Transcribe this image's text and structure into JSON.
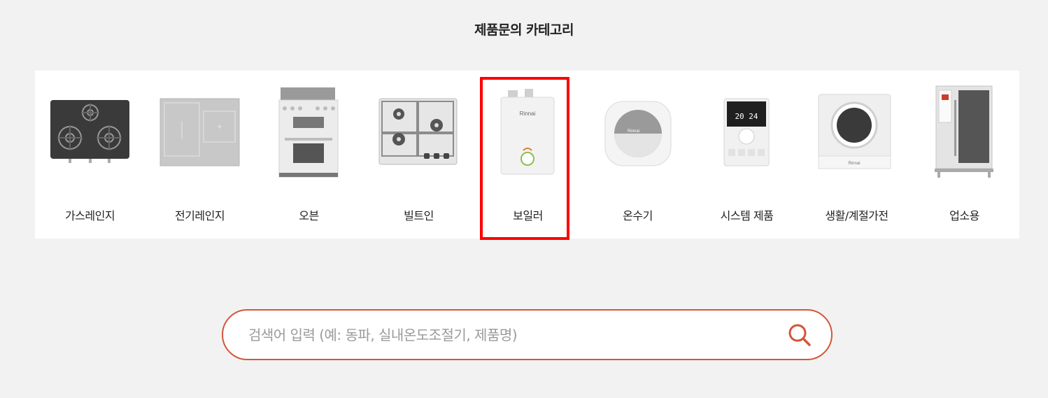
{
  "section": {
    "title": "제품문의 카테고리"
  },
  "categories": [
    {
      "label": "가스레인지",
      "icon": "gas-range-icon"
    },
    {
      "label": "전기레인지",
      "icon": "electric-range-icon"
    },
    {
      "label": "오븐",
      "icon": "oven-icon"
    },
    {
      "label": "빌트인",
      "icon": "built-in-cooktop-icon"
    },
    {
      "label": "보일러",
      "icon": "boiler-icon",
      "selected": true,
      "brand_text": "Rinnai"
    },
    {
      "label": "온수기",
      "icon": "water-heater-icon",
      "brand_text": "Rinnai"
    },
    {
      "label": "시스템 제품",
      "icon": "thermostat-icon",
      "display": "20 24"
    },
    {
      "label": "생활/계절가전",
      "icon": "dryer-icon",
      "brand_text": "Rinnai"
    },
    {
      "label": "업소용",
      "icon": "commercial-oven-icon"
    }
  ],
  "search": {
    "placeholder": "검색어 입력 (예: 동파, 실내온도조절기, 제품명)",
    "value": "",
    "icon": "search-icon"
  },
  "colors": {
    "accent": "#d4553a",
    "selected_frame": "#ff0000",
    "panel_bg": "#ffffff",
    "page_bg": "#f2f2f2"
  }
}
